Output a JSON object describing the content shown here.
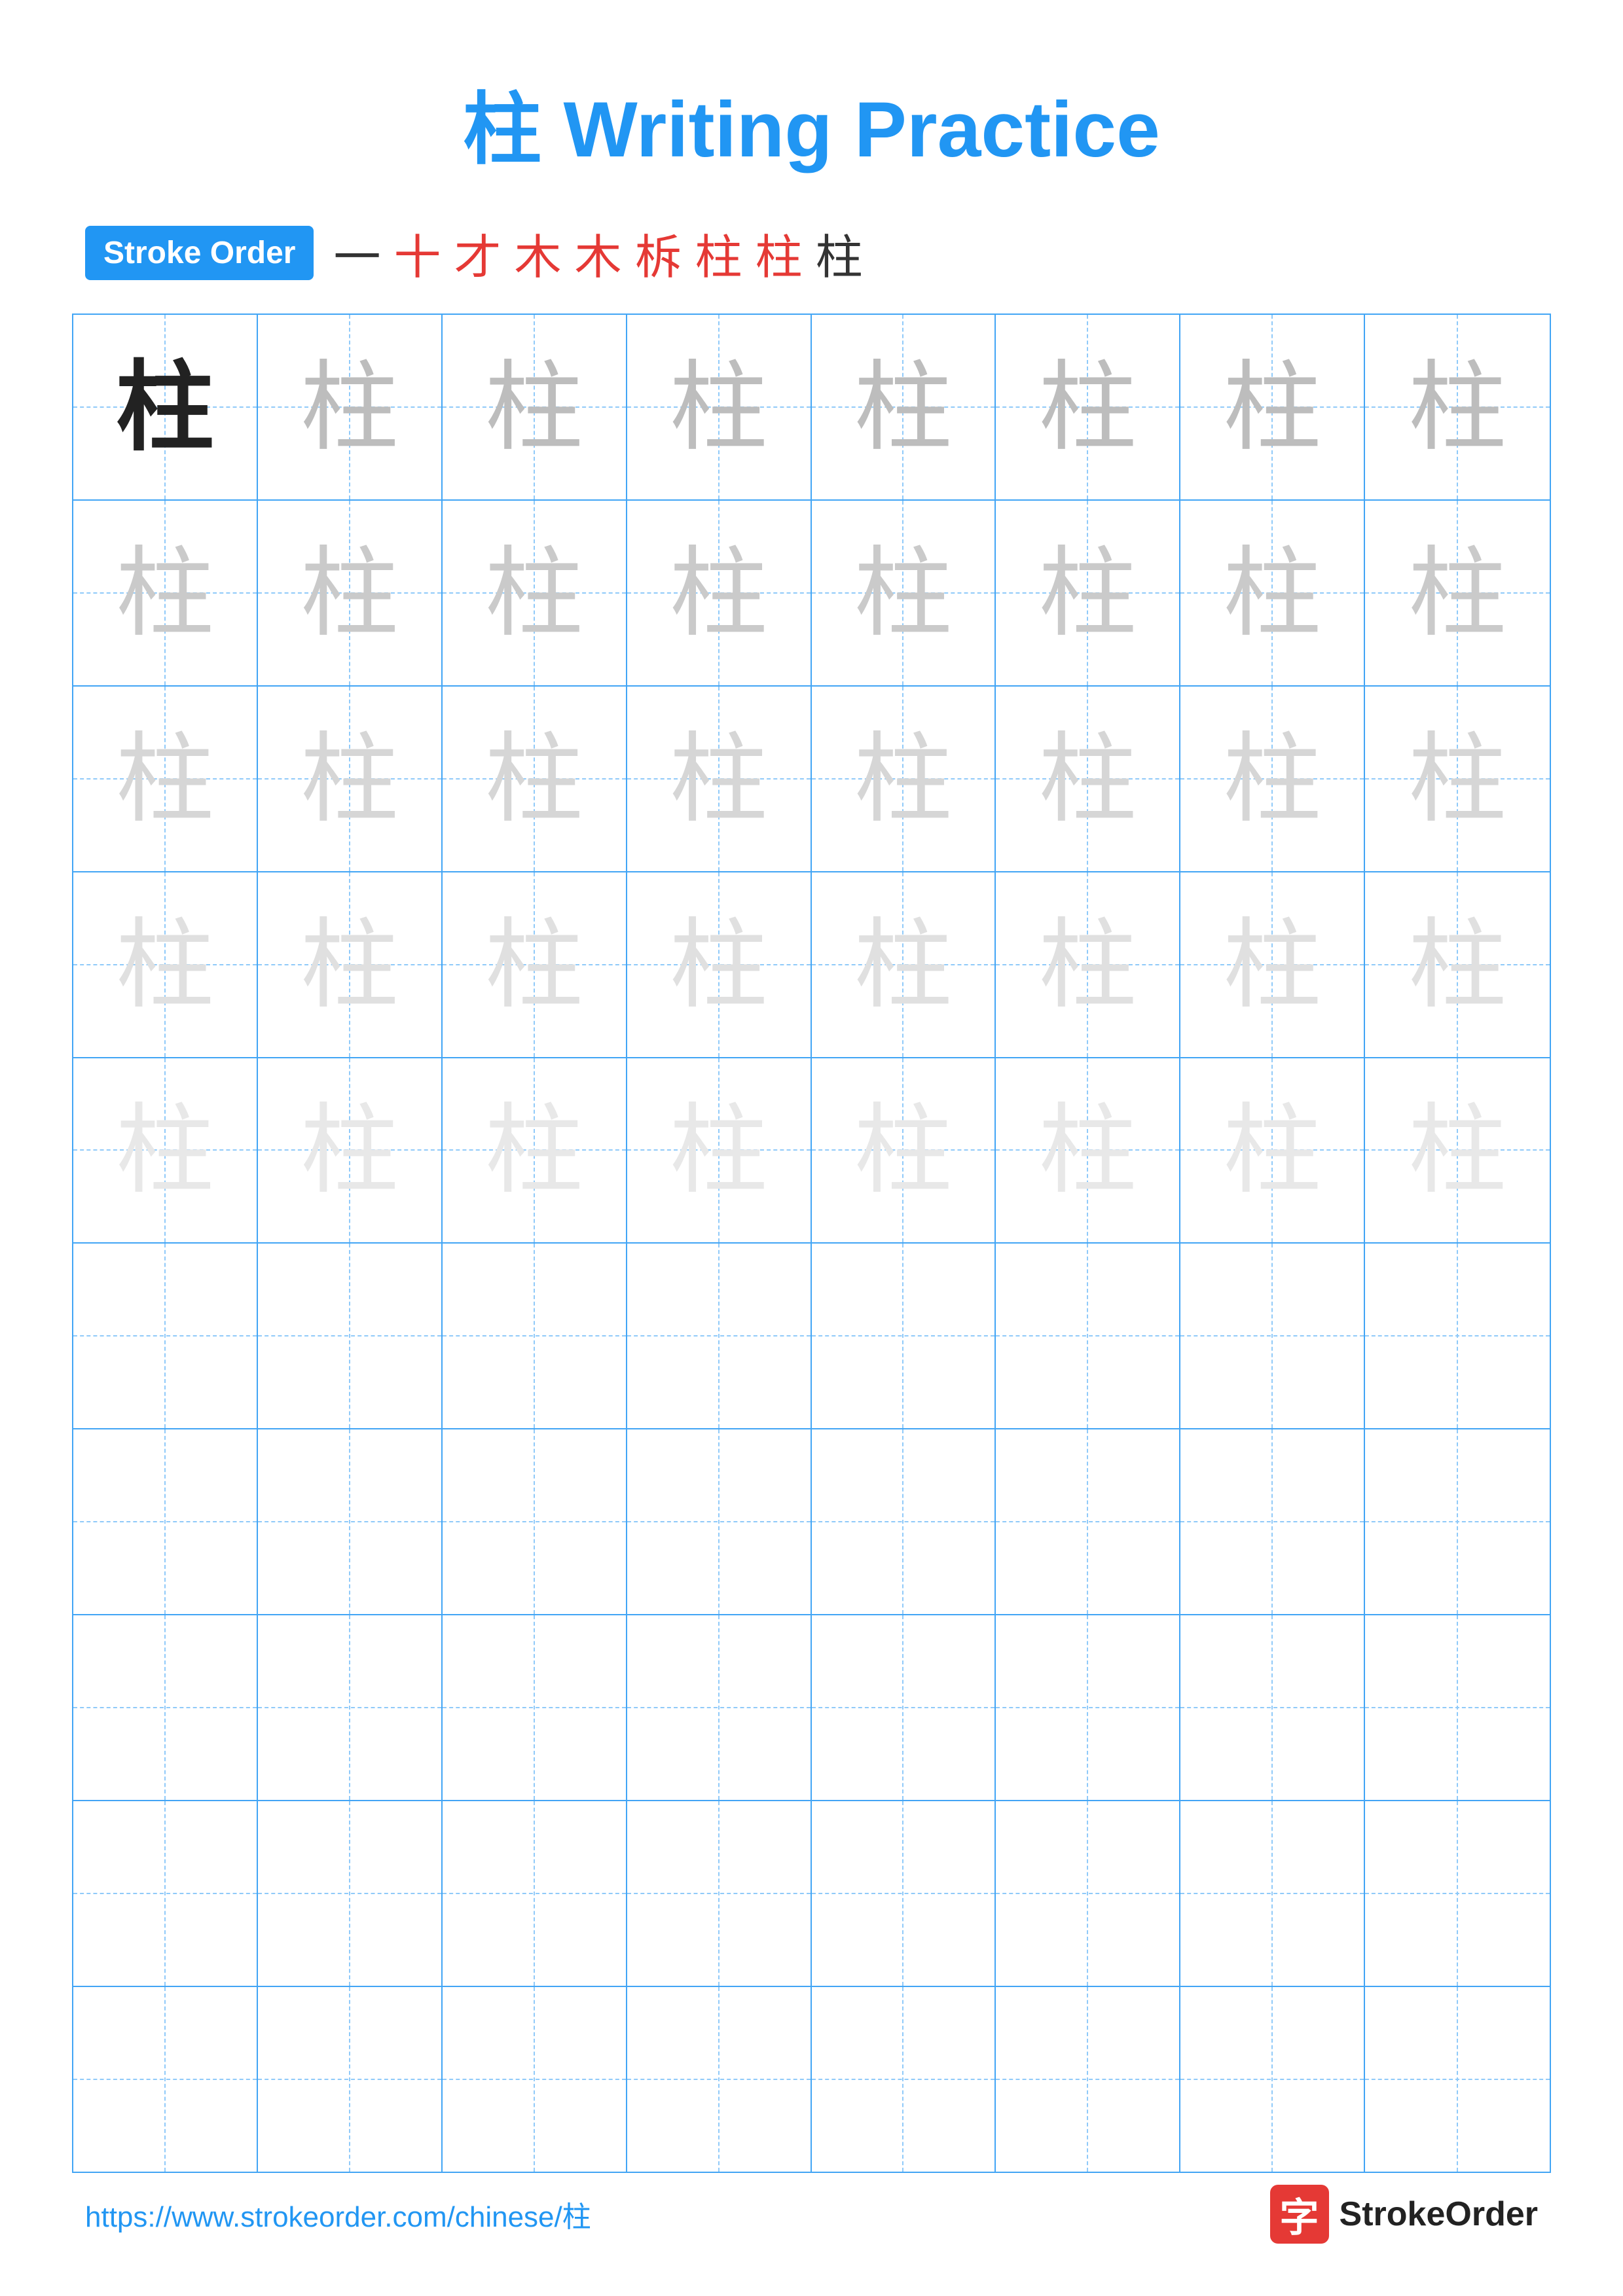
{
  "title": {
    "character": "柱",
    "text": "Writing Practice",
    "full": "柱 Writing Practice"
  },
  "stroke_order": {
    "badge_label": "Stroke Order",
    "strokes": [
      "一",
      "十",
      "才",
      "木",
      "木",
      "柝",
      "柱",
      "柱",
      "柱"
    ]
  },
  "grid": {
    "rows": 10,
    "cols": 8,
    "character": "柱",
    "practice_rows": 5,
    "empty_rows": 5
  },
  "footer": {
    "url": "https://www.strokeorder.com/chinese/柱",
    "logo_icon": "字",
    "logo_text": "StrokeOrder"
  }
}
